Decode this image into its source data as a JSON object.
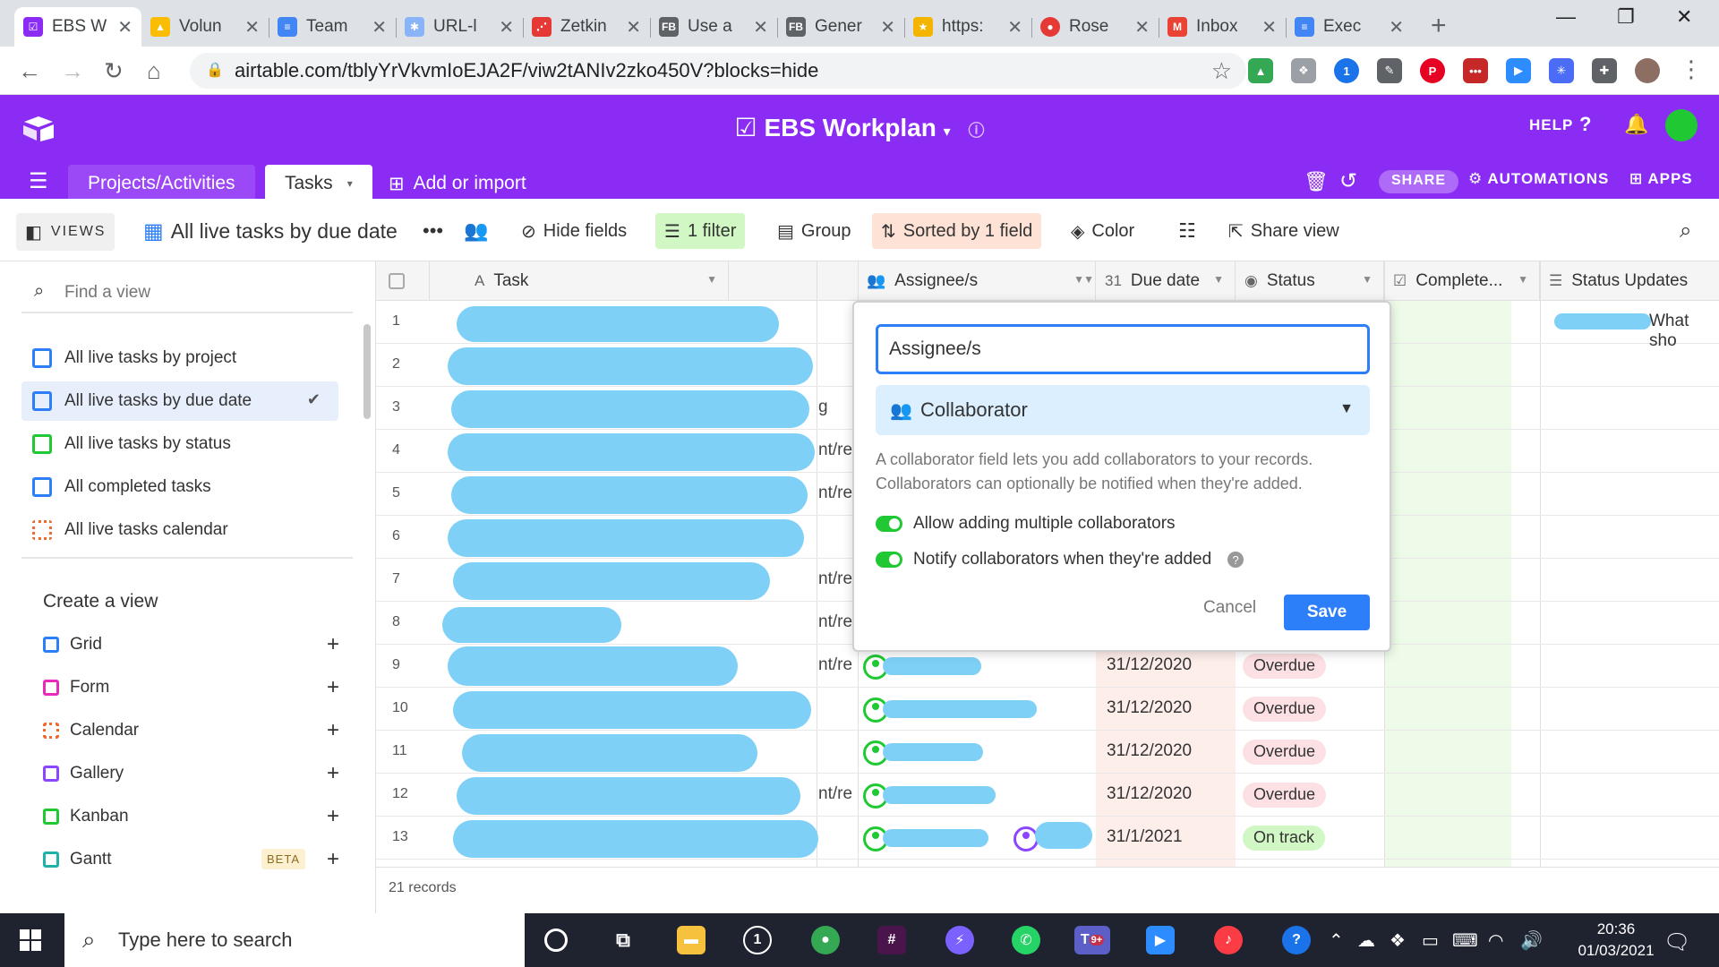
{
  "browser": {
    "tabs": [
      {
        "title": "EBS W",
        "color": "#8b2cf5",
        "glyph": "☑"
      },
      {
        "title": "Volun",
        "color": "#fbbc04",
        "glyph": "▲"
      },
      {
        "title": "Team",
        "color": "#4285f4",
        "glyph": "≡"
      },
      {
        "title": "URL-l",
        "color": "#8ab4f8",
        "glyph": "✱"
      },
      {
        "title": "Zetkin",
        "color": "#e53935",
        "glyph": "⋰"
      },
      {
        "title": "Use a",
        "color": "#5f6368",
        "glyph": "FB"
      },
      {
        "title": "Gener",
        "color": "#5f6368",
        "glyph": "FB"
      },
      {
        "title": "https:",
        "color": "#f4b400",
        "glyph": "★"
      },
      {
        "title": "Rose",
        "color": "#e53935",
        "glyph": "●"
      },
      {
        "title": "Inbox",
        "color": "#ea4335",
        "glyph": "M"
      },
      {
        "title": "Exec",
        "color": "#4285f4",
        "glyph": "≡"
      }
    ],
    "url": "airtable.com/tblyYrVkvmIoEJA2F/viw2tANIv2zko450V?blocks=hide"
  },
  "app": {
    "base_title": "EBS Workplan",
    "help": "HELP",
    "tables": {
      "projects": "Projects/Activities",
      "tasks": "Tasks",
      "add": "Add or import"
    },
    "share": "SHARE",
    "automations": "AUTOMATIONS",
    "apps": "APPS"
  },
  "viewbar": {
    "views": "VIEWS",
    "current_view": "All live tasks by due date",
    "hide_fields": "Hide fields",
    "filter": "1 filter",
    "group": "Group",
    "sorted": "Sorted by 1 field",
    "color": "Color",
    "share_view": "Share view"
  },
  "sidebar": {
    "find_placeholder": "Find a view",
    "views": [
      "All live tasks by project",
      "All live tasks by due date",
      "All live tasks by status",
      "All completed tasks",
      "All live tasks calendar"
    ],
    "create_heading": "Create a view",
    "create": [
      "Grid",
      "Form",
      "Calendar",
      "Gallery",
      "Kanban",
      "Gantt"
    ],
    "beta": "BETA"
  },
  "grid": {
    "columns": {
      "task": "Task",
      "assignee": "Assignee/s",
      "due": "Due date",
      "status": "Status",
      "complete": "Complete...",
      "updates": "Status Updates"
    },
    "rows": [
      {
        "n": "1",
        "frag": "",
        "due": "",
        "status": ""
      },
      {
        "n": "2",
        "frag": "",
        "due": "",
        "status": ""
      },
      {
        "n": "3",
        "frag": "g",
        "due": "",
        "status": ""
      },
      {
        "n": "4",
        "frag": "nt/re",
        "due": "",
        "status": ""
      },
      {
        "n": "5",
        "frag": "nt/re",
        "due": "",
        "status": ""
      },
      {
        "n": "6",
        "frag": "",
        "due": "",
        "status": ""
      },
      {
        "n": "7",
        "frag": "nt/re",
        "due": "",
        "status": ""
      },
      {
        "n": "8",
        "frag": "nt/re",
        "due": "",
        "status": ""
      },
      {
        "n": "9",
        "frag": "nt/re",
        "due": "31/12/2020",
        "status": "Overdue"
      },
      {
        "n": "10",
        "frag": "",
        "due": "31/12/2020",
        "status": "Overdue"
      },
      {
        "n": "11",
        "frag": "",
        "due": "31/12/2020",
        "status": "Overdue"
      },
      {
        "n": "12",
        "frag": "nt/re",
        "due": "31/12/2020",
        "status": "Overdue"
      },
      {
        "n": "13",
        "frag": "",
        "due": "31/1/2021",
        "status": "On track"
      }
    ],
    "update_snippet": "What sho",
    "records": "21 records"
  },
  "popover": {
    "field_name": "Assignee/s",
    "field_type": "Collaborator",
    "description": "A collaborator field lets you add collaborators to your records. Collaborators can optionally be notified when they're added.",
    "toggle_multiple": "Allow adding multiple collaborators",
    "toggle_notify": "Notify collaborators when they're added",
    "cancel": "Cancel",
    "save": "Save"
  },
  "taskbar": {
    "search_placeholder": "Type here to search",
    "time": "20:36",
    "date": "01/03/2021",
    "teams_badge": "9+"
  },
  "colors": {
    "brand": "#8b2cf5",
    "accent": "#2d7ff9",
    "overdue": "#fde0e3",
    "on_track": "#d1f7c4",
    "redaction": "#7fd0f7"
  }
}
